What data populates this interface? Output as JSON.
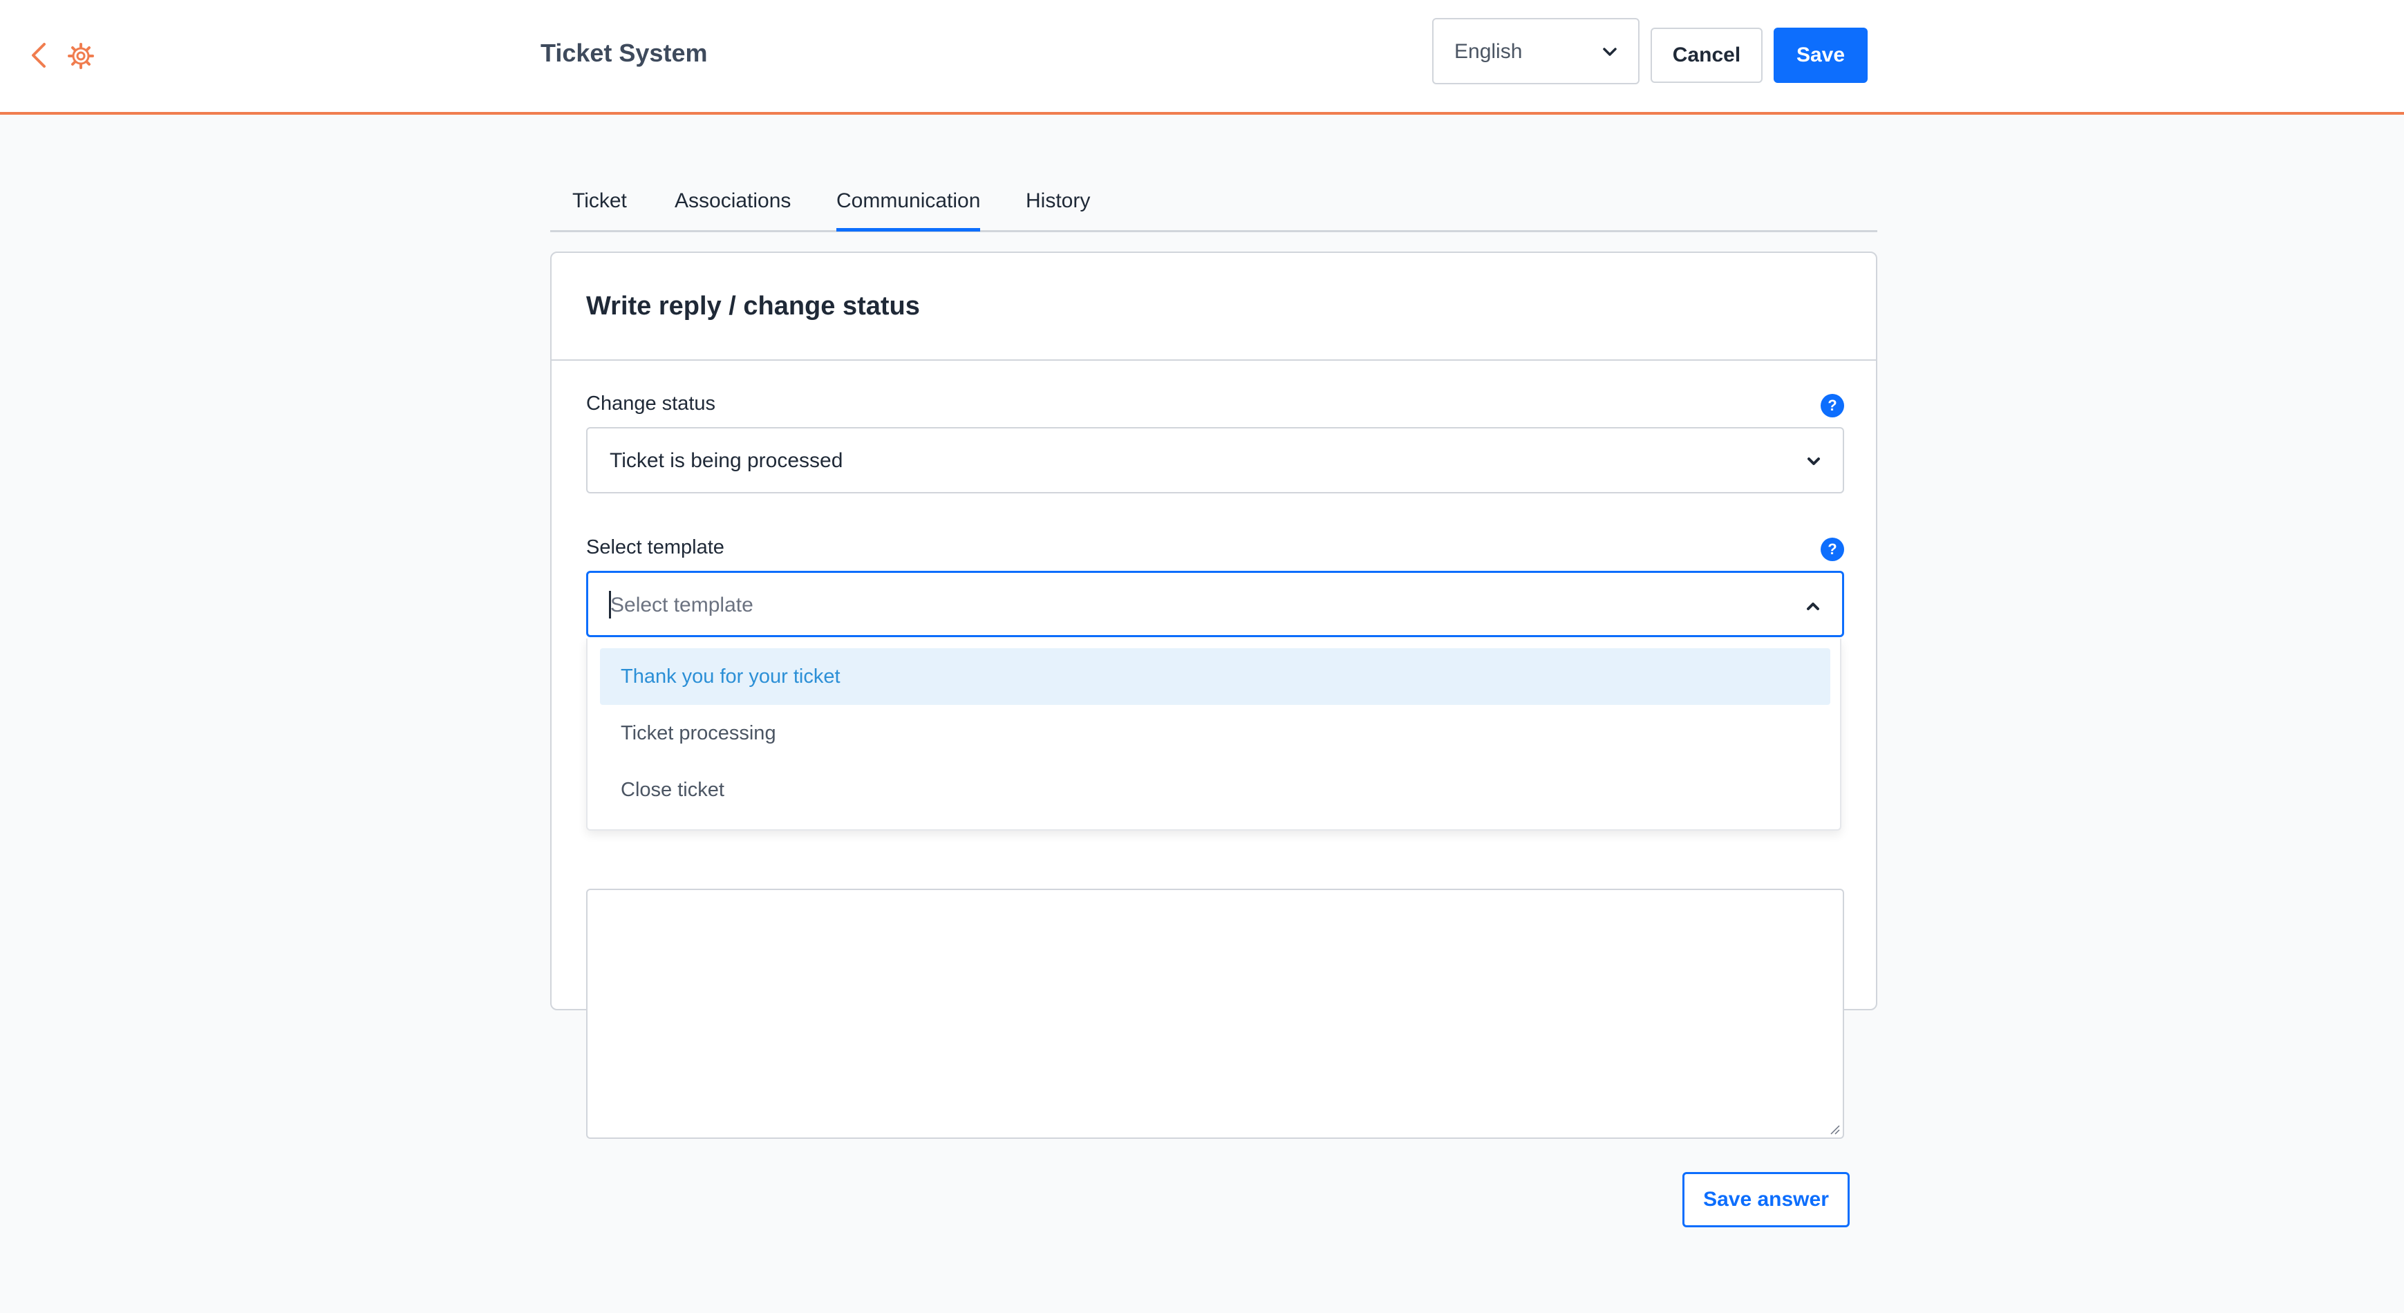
{
  "header": {
    "title": "Ticket System",
    "language": "English",
    "cancel_label": "Cancel",
    "save_label": "Save"
  },
  "tabs": [
    {
      "label": "Ticket",
      "active": false
    },
    {
      "label": "Associations",
      "active": false
    },
    {
      "label": "Communication",
      "active": true
    },
    {
      "label": "History",
      "active": false
    }
  ],
  "card": {
    "title": "Write reply / change status",
    "status_label": "Change status",
    "status_value": "Ticket is being processed",
    "template_label": "Select template",
    "template_placeholder": "Select template",
    "save_answer_label": "Save answer"
  },
  "template_options": [
    {
      "label": "Thank you for your ticket",
      "highlighted": true
    },
    {
      "label": "Ticket processing",
      "highlighted": false
    },
    {
      "label": "Close ticket",
      "highlighted": false
    }
  ],
  "colors": {
    "accent": "#0d6efd",
    "header_border": "#f07d4f",
    "icon": "#f07d4f",
    "highlight_bg": "#e6f2fc",
    "highlight_text": "#2b8fd6"
  }
}
